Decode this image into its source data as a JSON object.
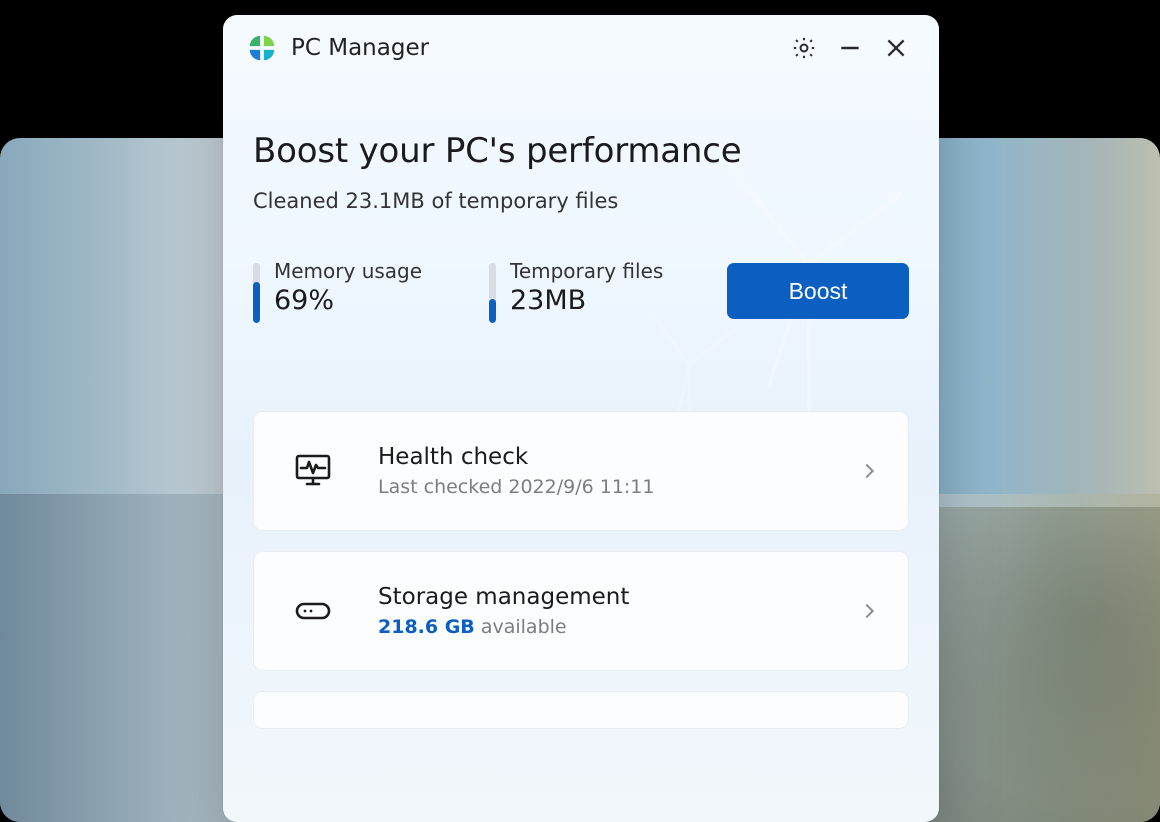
{
  "app": {
    "title": "PC Manager"
  },
  "hero": {
    "title": "Boost your PC's performance",
    "subtitle": "Cleaned 23.1MB of temporary files"
  },
  "stats": {
    "memory": {
      "label": "Memory usage",
      "value": "69%",
      "fill_pct": 69
    },
    "temp": {
      "label": "Temporary files",
      "value": "23MB",
      "fill_pct": 40
    }
  },
  "actions": {
    "boost_label": "Boost"
  },
  "cards": {
    "health": {
      "title": "Health check",
      "subtitle": "Last checked 2022/9/6 11:11"
    },
    "storage": {
      "title": "Storage management",
      "available_value": "218.6 GB",
      "available_suffix": " available"
    }
  },
  "colors": {
    "accent": "#0b5fc0"
  }
}
